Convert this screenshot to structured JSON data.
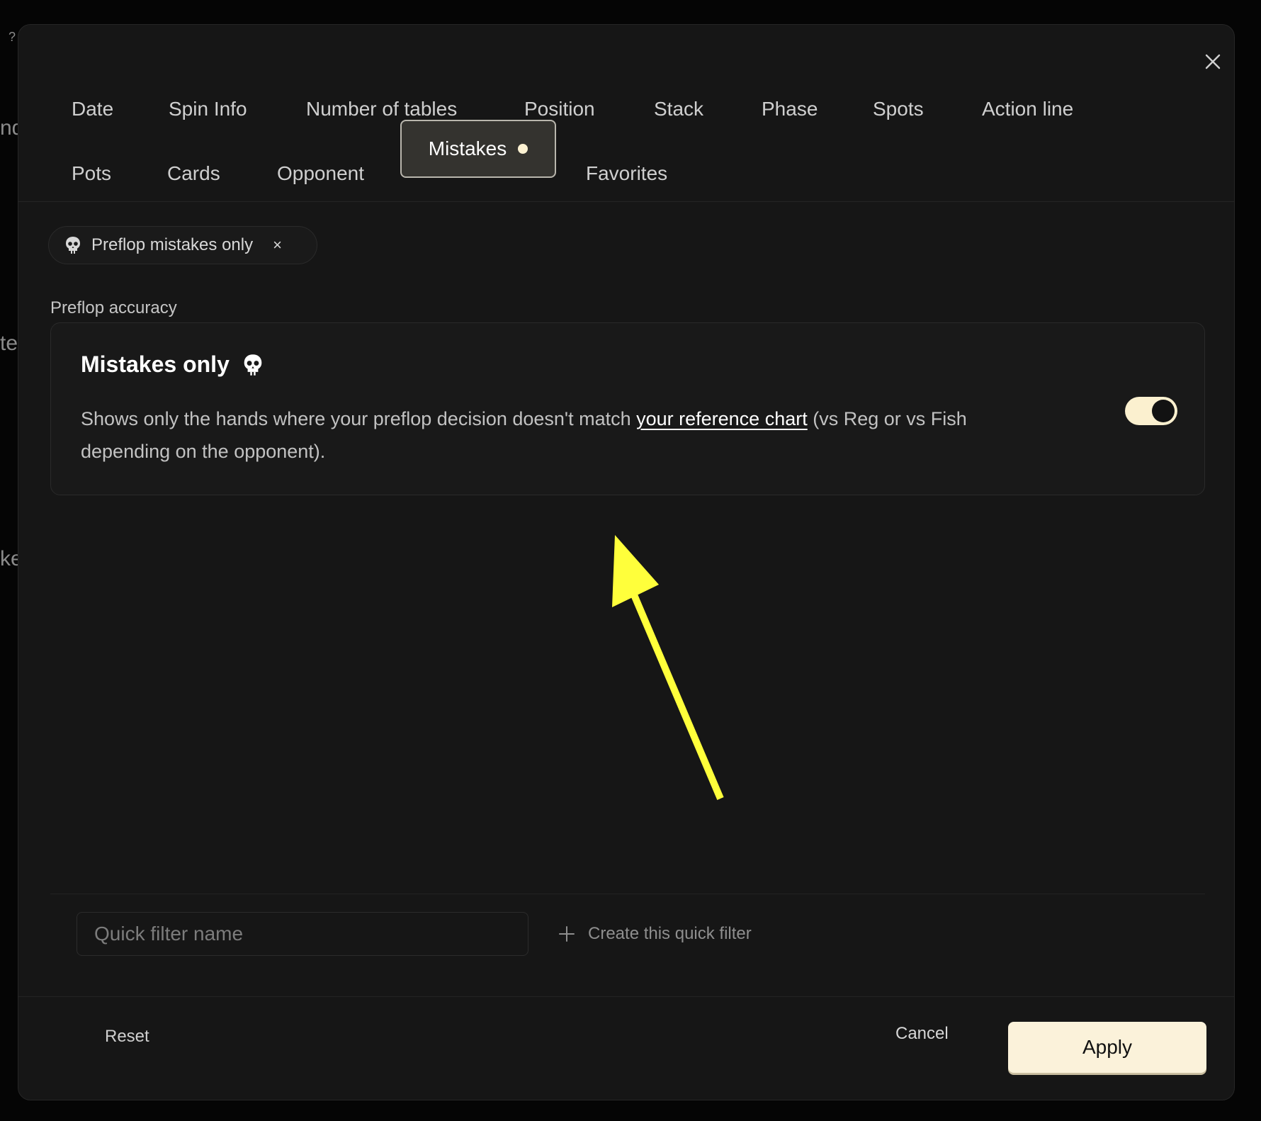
{
  "background": {
    "fragments": [
      "?",
      "nd",
      "te",
      "ke"
    ]
  },
  "modal": {
    "close_icon": "close-icon",
    "tabs_row1": [
      {
        "label": "Date"
      },
      {
        "label": "Spin Info"
      },
      {
        "label": "Number of tables"
      },
      {
        "label": "Position"
      },
      {
        "label": "Stack"
      },
      {
        "label": "Phase"
      },
      {
        "label": "Spots"
      },
      {
        "label": "Action line"
      }
    ],
    "tabs_row2": [
      {
        "label": "Pots"
      },
      {
        "label": "Cards"
      },
      {
        "label": "Opponent"
      },
      {
        "label": "Mistakes",
        "active": true,
        "indicator": "active-dot"
      },
      {
        "label": "Favorites"
      }
    ],
    "active_filter_chip": {
      "icon": "skull-icon",
      "label": "Preflop mistakes only",
      "remove_glyph": "×"
    },
    "section": {
      "label": "Preflop accuracy",
      "card": {
        "title": "Mistakes only",
        "title_icon": "skull-icon",
        "description_before": "Shows only the hands where your preflop decision doesn't match ",
        "description_link": "your reference chart",
        "description_after": " (vs Reg or vs Fish depending on the opponent).",
        "toggle_on": true
      }
    },
    "annotation": {
      "type": "arrow",
      "color": "#FFFF3B"
    },
    "quick_filter": {
      "input_value": "",
      "input_placeholder": "Quick filter name",
      "create_icon": "plus-icon",
      "create_label": "Create this quick filter"
    },
    "footer": {
      "reset_label": "Reset",
      "cancel_label": "Cancel",
      "apply_label": "Apply"
    }
  },
  "colors": {
    "modal_bg": "#161616",
    "accent_cream": "#FBF2DA",
    "active_tab_bg": "#34332F",
    "arrow_yellow": "#FFFF3B"
  }
}
